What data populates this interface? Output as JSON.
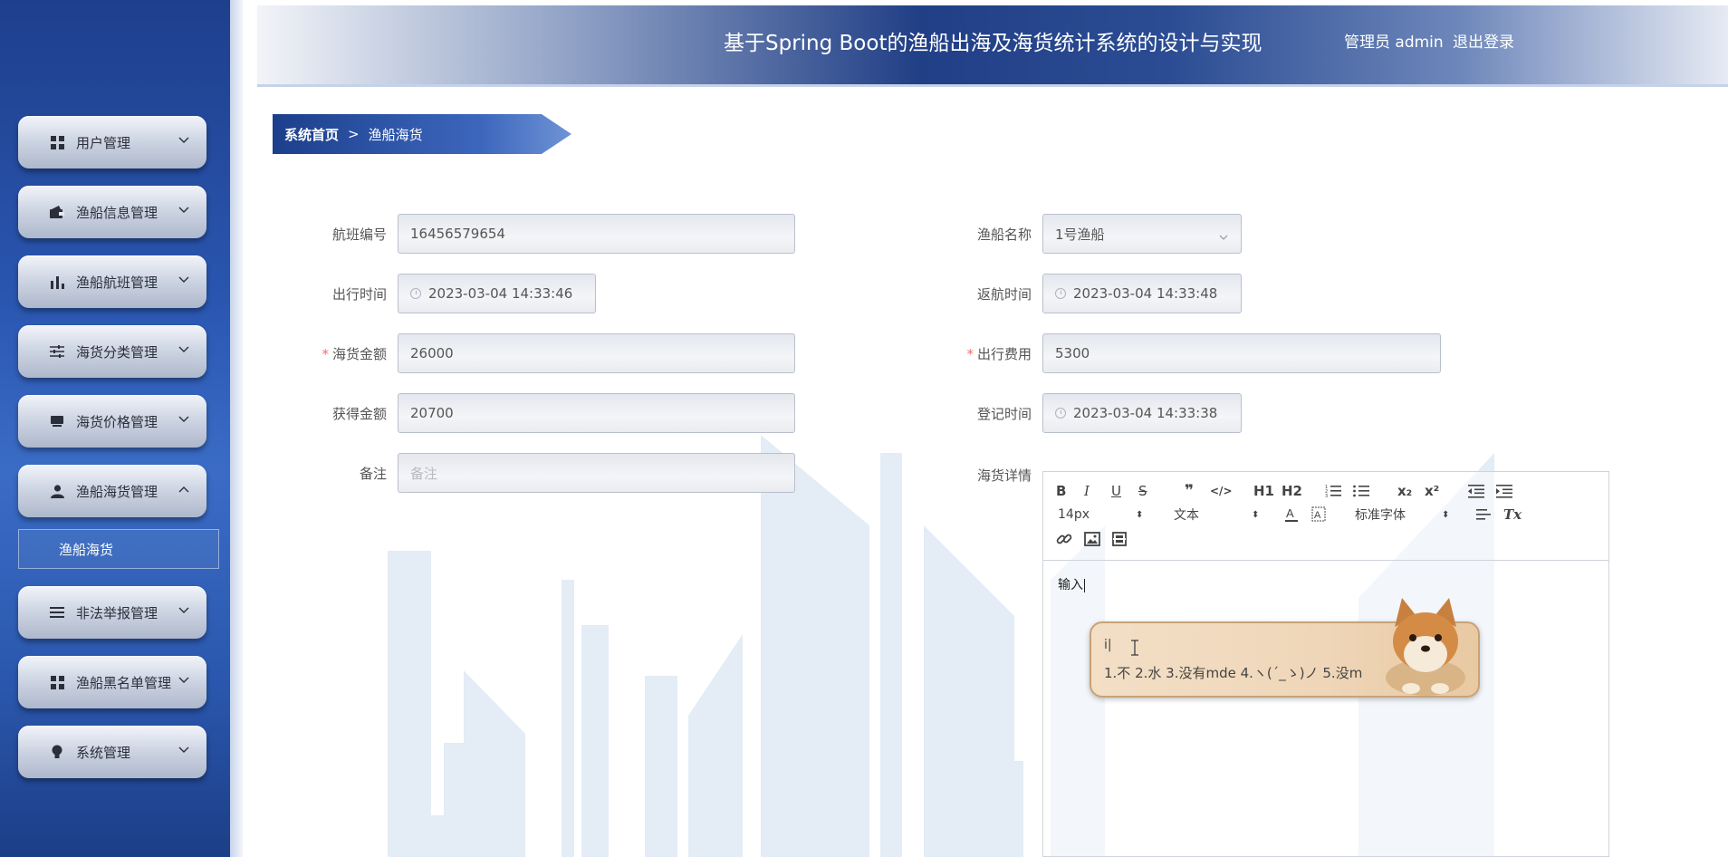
{
  "header": {
    "title": "基于Spring Boot的渔船出海及海货统计系统的设计与实现",
    "user": "管理员 admin",
    "logout": "退出登录"
  },
  "sidebar": {
    "items": [
      {
        "label": "用户管理",
        "icon": "grid-icon",
        "expanded": false
      },
      {
        "label": "渔船信息管理",
        "icon": "wallet-icon",
        "expanded": false
      },
      {
        "label": "渔船航班管理",
        "icon": "bar-chart-icon",
        "expanded": false
      },
      {
        "label": "海货分类管理",
        "icon": "sliders-icon",
        "expanded": false
      },
      {
        "label": "海货价格管理",
        "icon": "tag-icon",
        "expanded": false
      },
      {
        "label": "渔船海货管理",
        "icon": "user-icon",
        "expanded": true
      },
      {
        "label": "非法举报管理",
        "icon": "list-icon",
        "expanded": false
      },
      {
        "label": "渔船黑名单管理",
        "icon": "grid-icon",
        "expanded": false
      },
      {
        "label": "系统管理",
        "icon": "bulb-icon",
        "expanded": false
      }
    ],
    "submenu_item": "渔船海货"
  },
  "breadcrumb": {
    "home": "系统首页",
    "separator": ">",
    "current": "渔船海货"
  },
  "form": {
    "flight_no": {
      "label": "航班编号",
      "value": "16456579654"
    },
    "boat_name": {
      "label": "渔船名称",
      "value": "1号渔船"
    },
    "depart_time": {
      "label": "出行时间",
      "value": "2023-03-04 14:33:46"
    },
    "return_time": {
      "label": "返航时间",
      "value": "2023-03-04 14:33:48"
    },
    "seafood_amount": {
      "label": "海货金额",
      "value": "26000",
      "required": "*"
    },
    "travel_cost": {
      "label": "出行费用",
      "value": "5300",
      "required": "*"
    },
    "earned_amount": {
      "label": "获得金额",
      "value": "20700"
    },
    "register_time": {
      "label": "登记时间",
      "value": "2023-03-04 14:33:38"
    },
    "remark": {
      "label": "备注",
      "placeholder": "备注"
    },
    "details": {
      "label": "海货详情"
    }
  },
  "editor": {
    "toolbar": {
      "bold": "B",
      "italic": "I",
      "underline": "U",
      "strike": "S",
      "quote": "❞",
      "code": "</>",
      "h1": "H1",
      "h2": "H2",
      "subscript": "x₂",
      "superscript": "x²",
      "font_size": "14px",
      "block_type": "文本",
      "font_family": "标准字体",
      "clear_format": "Tx"
    },
    "content": "输入"
  },
  "ime": {
    "composition": "i|",
    "candidates": "1.不  2.水  3.没有mde  4.ヽ(´_ゝ)ノ  5.没m"
  }
}
